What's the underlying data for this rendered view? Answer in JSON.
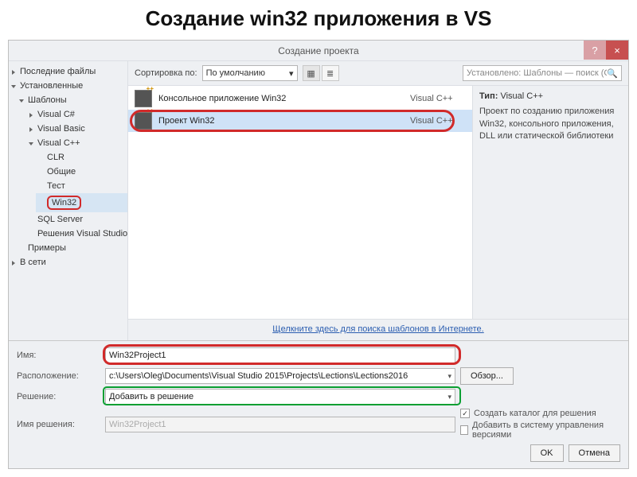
{
  "slide_title": "Создание win32 приложения в VS",
  "dialog": {
    "title": "Создание проекта",
    "help": "?",
    "close": "×"
  },
  "left": {
    "recent": "Последние файлы",
    "installed": "Установленные",
    "templates": "Шаблоны",
    "visual_csharp": "Visual C#",
    "visual_basic": "Visual Basic",
    "visual_cpp": "Visual C++",
    "clr": "CLR",
    "common": "Общие",
    "test": "Тест",
    "win32": "Win32",
    "sql_server": "SQL Server",
    "vs_solutions": "Решения Visual Studio",
    "examples": "Примеры",
    "online": "В сети"
  },
  "toolbar": {
    "sort_label": "Сортировка по:",
    "sort_value": "По умолчанию",
    "search_placeholder": "Установлено: Шаблоны — поиск (Ctr"
  },
  "templates": [
    {
      "name": "Консольное приложение Win32",
      "lang": "Visual C++"
    },
    {
      "name": "Проект Win32",
      "lang": "Visual C++"
    }
  ],
  "desc": {
    "type_label": "Тип:",
    "type_value": "Visual C++",
    "text": "Проект по созданию приложения Win32, консольного приложения, DLL или статической библиотеки"
  },
  "link": "Щелкните здесь для поиска шаблонов в Интернете.",
  "form": {
    "name_label": "Имя:",
    "name_value": "Win32Project1",
    "location_label": "Расположение:",
    "location_value": "c:\\Users\\Oleg\\Documents\\Visual Studio 2015\\Projects\\Lections\\Lections2016",
    "solution_label": "Решение:",
    "solution_value": "Добавить в решение",
    "solution_name_label": "Имя решения:",
    "solution_name_value": "Win32Project1",
    "browse": "Обзор...",
    "chk_create_dir": "Создать каталог для решения",
    "chk_add_scm": "Добавить в систему управления версиями",
    "ok": "OK",
    "cancel": "Отмена"
  }
}
